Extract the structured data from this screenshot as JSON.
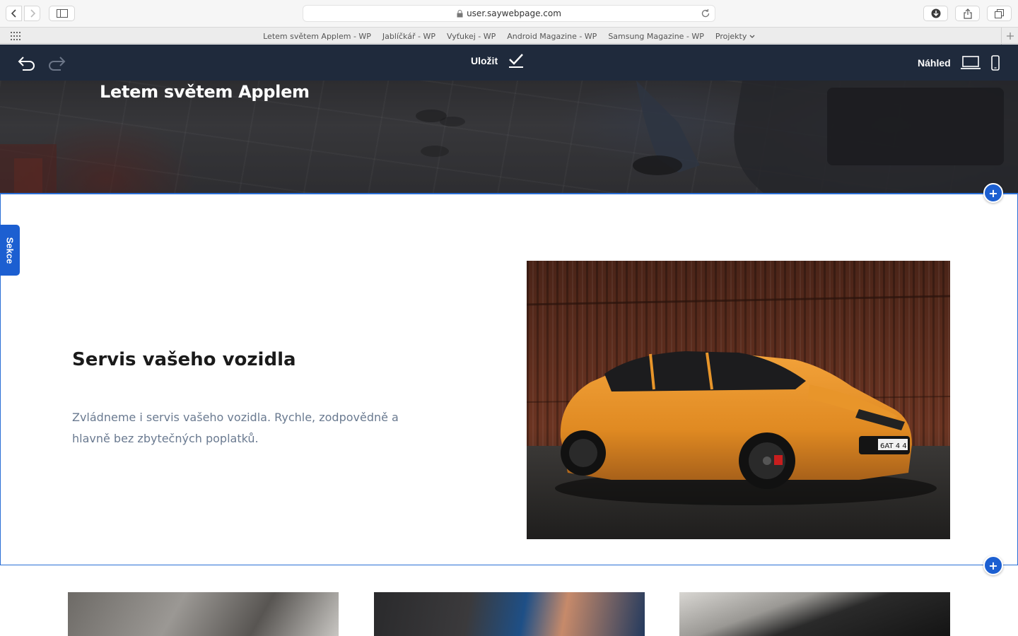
{
  "browser": {
    "url": "user.saywebpage.com",
    "favorites": [
      {
        "label": "Letem světem Applem - WP"
      },
      {
        "label": "Jablíčkář - WP"
      },
      {
        "label": "Vyťukej - WP"
      },
      {
        "label": "Android Magazine - WP"
      },
      {
        "label": "Samsung Magazine - WP"
      },
      {
        "label": "Projekty"
      }
    ]
  },
  "editor": {
    "save_label": "Uložit",
    "preview_label": "Náhled"
  },
  "hero": {
    "title": "Letem světem Applem"
  },
  "section": {
    "tab_label": "Sekce",
    "heading": "Servis vašeho vozidla",
    "text": "Zvládneme i servis vašeho vozidla. Rychle, zodpovědně a hlavně bez zbytečných poplatků.",
    "add_label": "+",
    "plate_text": "6AT 4 4"
  },
  "colors": {
    "editor_bar": "#1f2a3c",
    "accent": "#1c5fd1",
    "text_muted": "#6a7a90",
    "car_body": "#e8952a"
  }
}
